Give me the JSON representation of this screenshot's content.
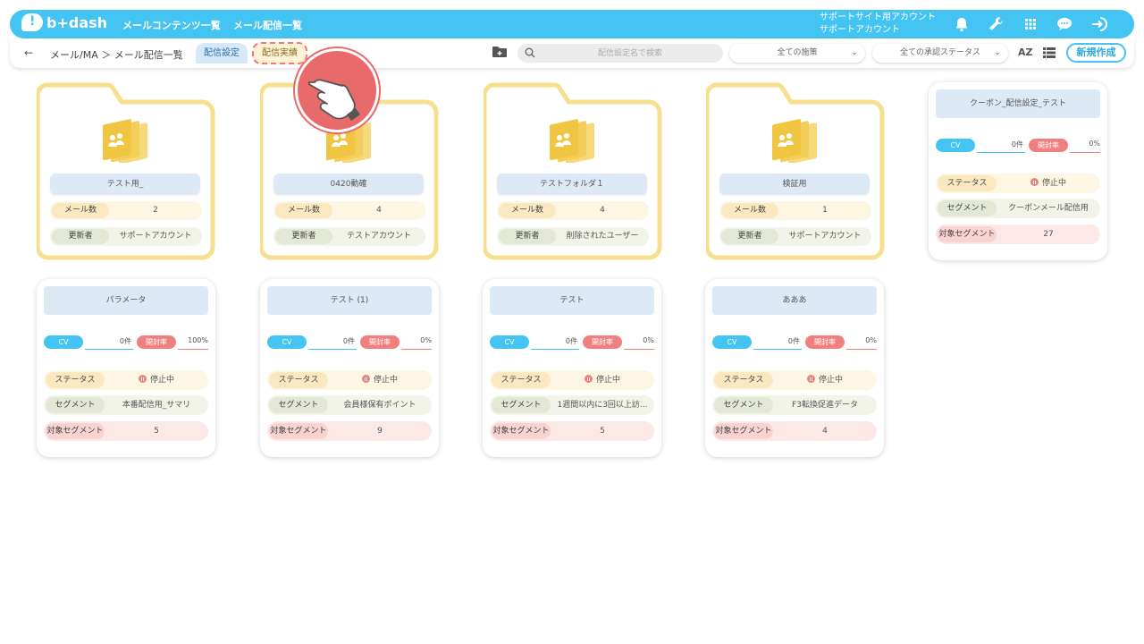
{
  "header": {
    "logo_text": "b+dash",
    "nav": [
      "メールコンテンツ一覧",
      "メール配信一覧"
    ],
    "account_line1": "サポートサイト用アカウント",
    "account_line2": "サポートアカウント",
    "icons": [
      "bell-icon",
      "wrench-icon",
      "grid-icon",
      "chat-icon",
      "logout-icon"
    ]
  },
  "subbar": {
    "back": "←",
    "breadcrumb": "メール/MA ＞ メール配信一覧",
    "tab_settings": "配信設定",
    "tab_results": "配信実績",
    "search_placeholder": "配信設定名で検索",
    "filter_measure": "全ての施策",
    "filter_status": "全ての承認ステータス",
    "sort_label": "AZ",
    "new_button": "新規作成"
  },
  "folders": [
    {
      "name": "テスト用_",
      "mail_label": "メール数",
      "mail_count": "2",
      "updater_label": "更新者",
      "updater": "サポートアカウント"
    },
    {
      "name": "0420動確",
      "mail_label": "メール数",
      "mail_count": "4",
      "updater_label": "更新者",
      "updater": "テストアカウント"
    },
    {
      "name": "テストフォルダ１",
      "mail_label": "メール数",
      "mail_count": "4",
      "updater_label": "更新者",
      "updater": "削除されたユーザー"
    },
    {
      "name": "検証用",
      "mail_label": "メール数",
      "mail_count": "1",
      "updater_label": "更新者",
      "updater": "サポートアカウント"
    }
  ],
  "cards": [
    {
      "title": "クーポン_配信設定_テスト",
      "cv_label": "CV",
      "cv_value": "0件",
      "open_label": "開封率",
      "open_value": "0%",
      "status_label": "ステータス",
      "status": "停止中",
      "segment_label": "セグメント",
      "segment": "クーポンメール配信用",
      "target_label": "対象セグメント",
      "target": "27"
    },
    {
      "title": "パラメータ",
      "cv_label": "CV",
      "cv_value": "0件",
      "open_label": "開封率",
      "open_value": "100%",
      "status_label": "ステータス",
      "status": "停止中",
      "segment_label": "セグメント",
      "segment": "本番配信用_サマリ",
      "target_label": "対象セグメント",
      "target": "5"
    },
    {
      "title": "テスト (1)",
      "cv_label": "CV",
      "cv_value": "0件",
      "open_label": "開封率",
      "open_value": "0%",
      "status_label": "ステータス",
      "status": "停止中",
      "segment_label": "セグメント",
      "segment": "会員様保有ポイント",
      "target_label": "対象セグメント",
      "target": "9"
    },
    {
      "title": "テスト",
      "cv_label": "CV",
      "cv_value": "0件",
      "open_label": "開封率",
      "open_value": "0%",
      "status_label": "ステータス",
      "status": "停止中",
      "segment_label": "セグメント",
      "segment": "1週間以内に3回以上訪...",
      "target_label": "対象セグメント",
      "target": "5"
    },
    {
      "title": "あああ",
      "cv_label": "CV",
      "cv_value": "0件",
      "open_label": "開封率",
      "open_value": "0%",
      "status_label": "ステータス",
      "status": "停止中",
      "segment_label": "セグメント",
      "segment": "F3転換促進データ",
      "target_label": "対象セグメント",
      "target": "4"
    }
  ],
  "colors": {
    "primary": "#44c4f2",
    "folder": "#f7df8e",
    "accent_red": "#f08080",
    "title_pill": "#ddeaf6"
  }
}
